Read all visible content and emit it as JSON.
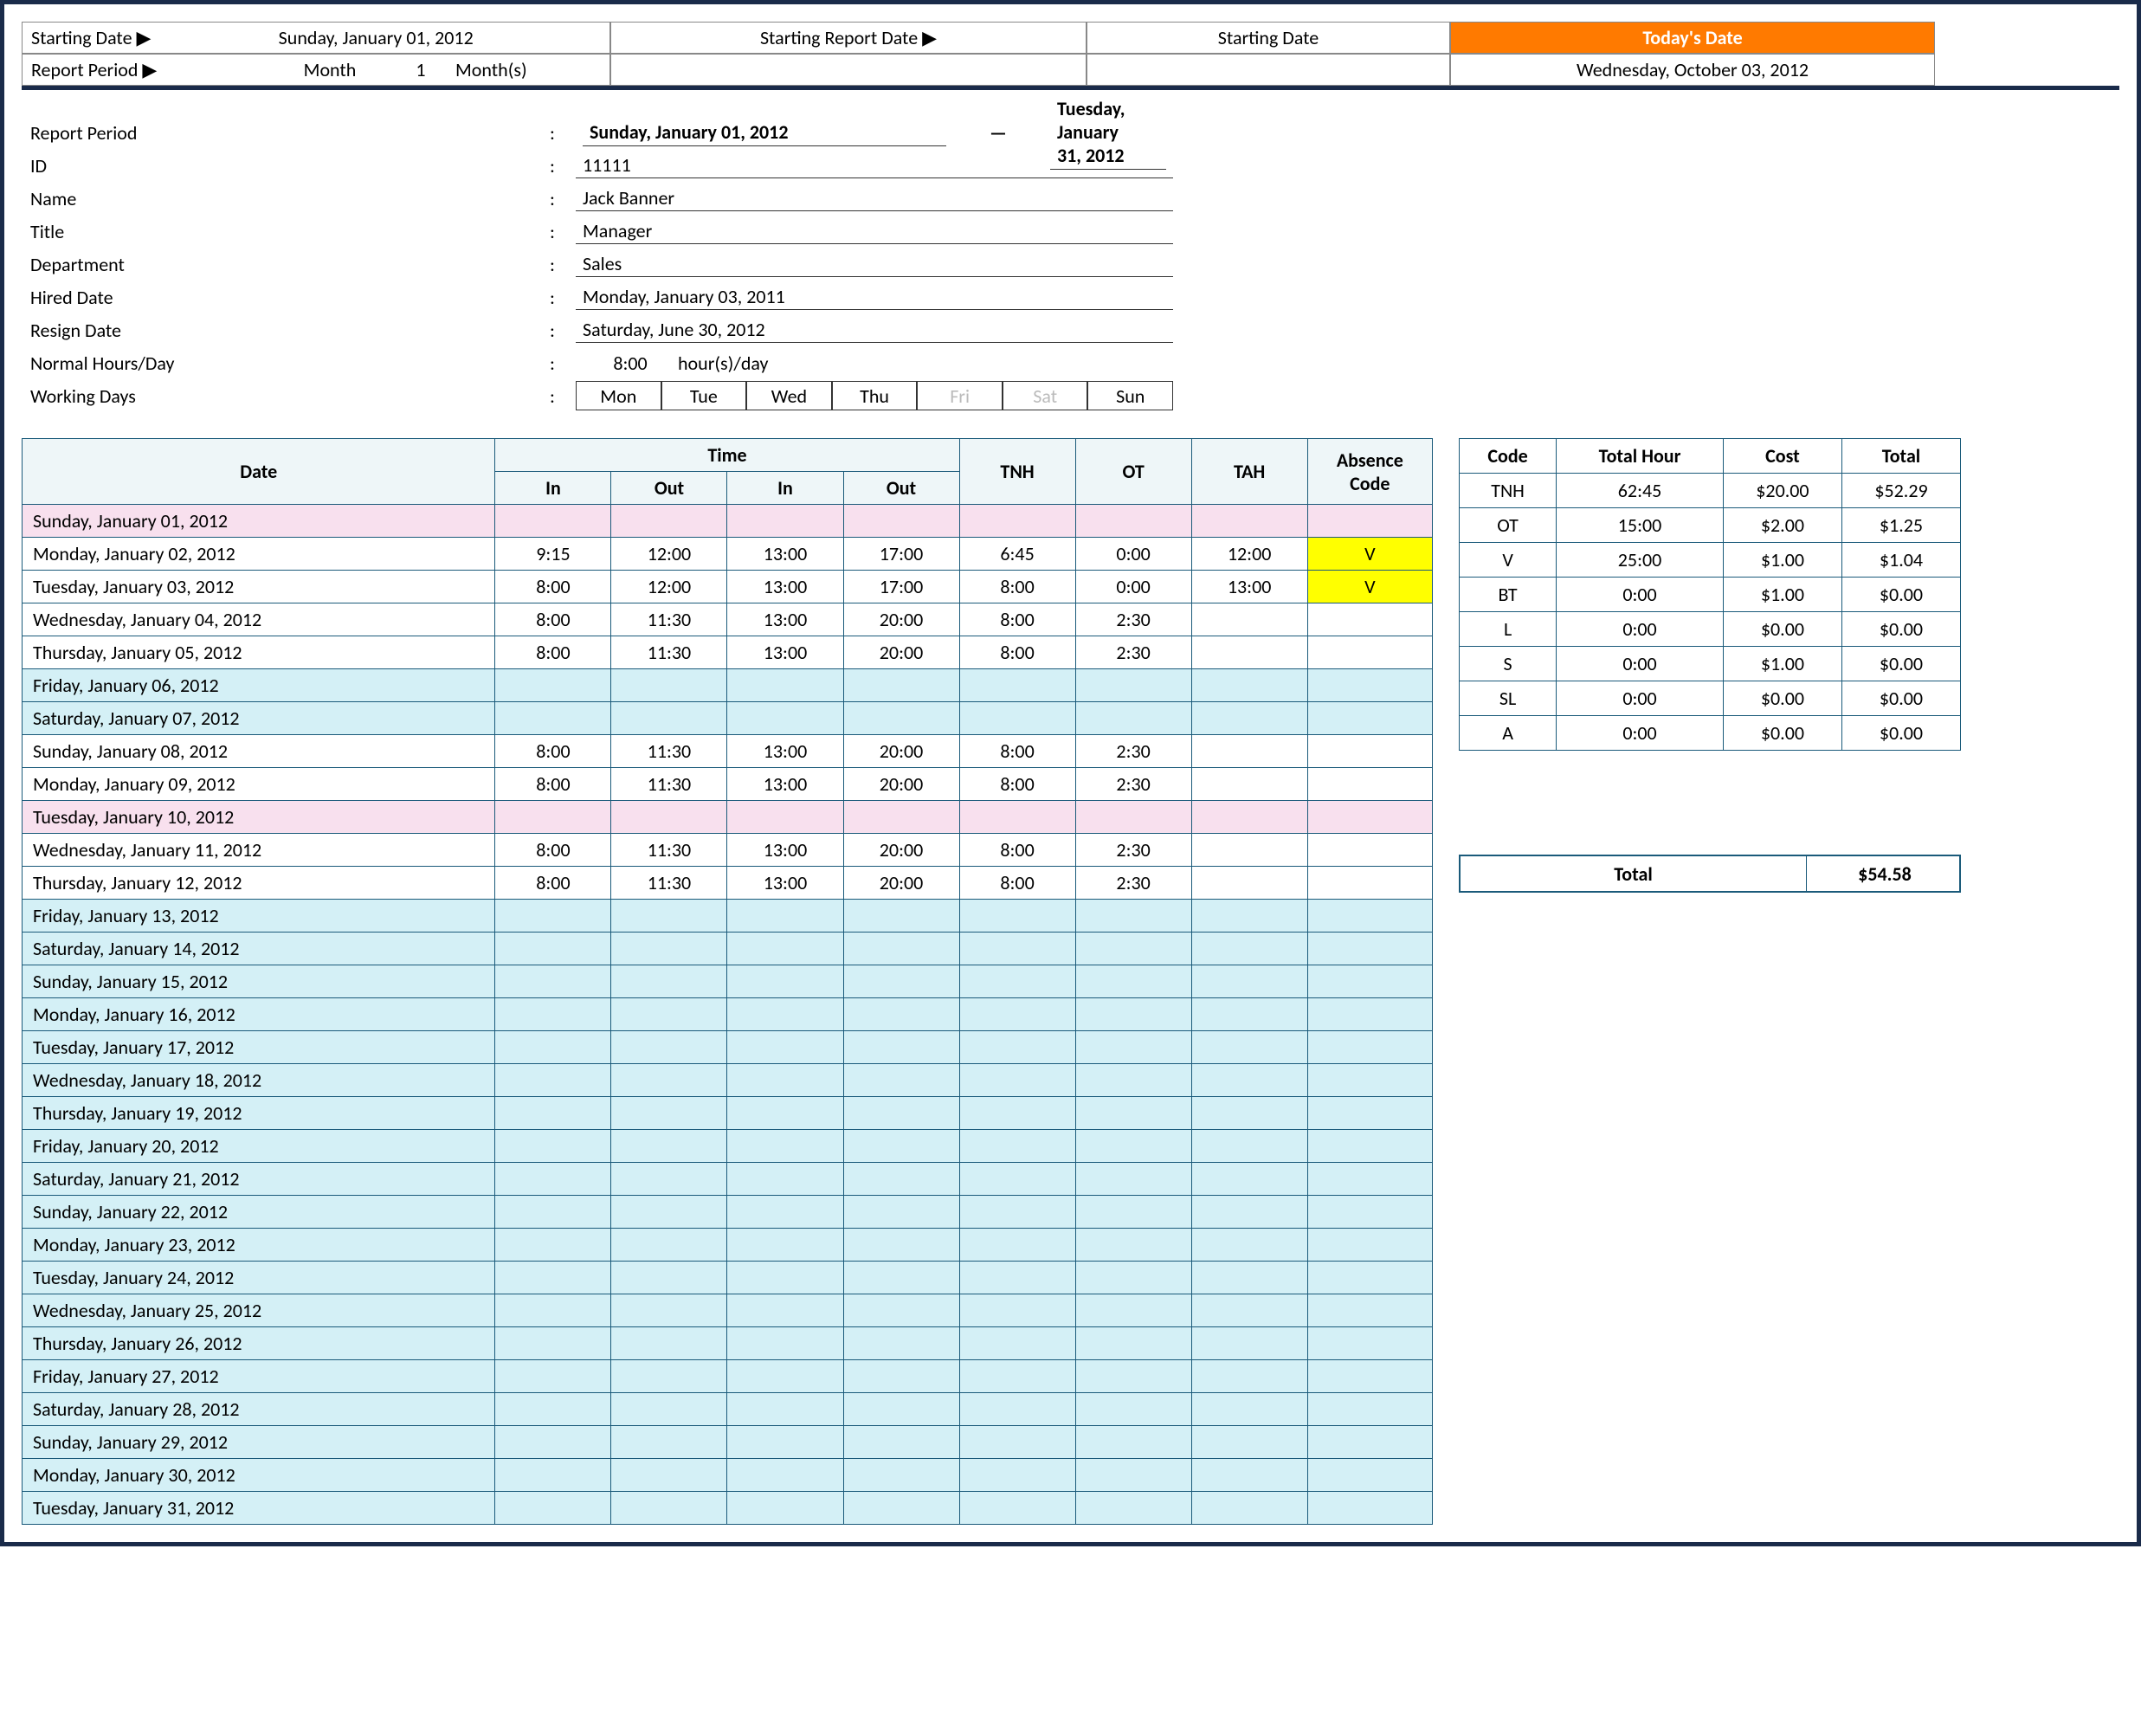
{
  "header": {
    "starting_date_label": "Starting Date ▶",
    "starting_date_value": "Sunday, January 01, 2012",
    "report_period_label": "Report Period ▶",
    "report_period_type": "Month",
    "report_period_count": "1",
    "report_period_unit": "Month(s)",
    "starting_report_date_label": "Starting Report Date ▶",
    "starting_report_date_value": "Starting Date",
    "todays_date_label": "Today's Date",
    "todays_date_value": "Wednesday, October 03, 2012"
  },
  "info": {
    "labels": {
      "report_period": "Report Period",
      "id": "ID",
      "name": "Name",
      "title": "Title",
      "department": "Department",
      "hired_date": "Hired Date",
      "resign_date": "Resign Date",
      "normal_hours": "Normal Hours/Day",
      "working_days": "Working Days"
    },
    "values": {
      "period_start": "Sunday, January 01, 2012",
      "period_sep": "—",
      "period_end": "Tuesday, January 31, 2012",
      "id": "11111",
      "name": "Jack Banner",
      "title": "Manager",
      "department": "Sales",
      "hired_date": "Monday, January 03, 2011",
      "resign_date": "Saturday, June 30, 2012",
      "hours_value": "8:00",
      "hours_unit": "hour(s)/day"
    },
    "days": [
      {
        "label": "Mon",
        "on": true
      },
      {
        "label": "Tue",
        "on": true
      },
      {
        "label": "Wed",
        "on": true
      },
      {
        "label": "Thu",
        "on": true
      },
      {
        "label": "Fri",
        "on": false
      },
      {
        "label": "Sat",
        "on": false
      },
      {
        "label": "Sun",
        "on": true
      }
    ]
  },
  "timesheet": {
    "headers": {
      "date": "Date",
      "time": "Time",
      "in": "In",
      "out": "Out",
      "tnh": "TNH",
      "ot": "OT",
      "tah": "TAH",
      "absence": "Absence Code"
    },
    "rows": [
      {
        "date": "Sunday, January 01, 2012",
        "cls": "row-pink"
      },
      {
        "date": "Monday, January 02, 2012",
        "in1": "9:15",
        "out1": "12:00",
        "in2": "13:00",
        "out2": "17:00",
        "tnh": "6:45",
        "ot": "0:00",
        "tah": "12:00",
        "abs": "V"
      },
      {
        "date": "Tuesday, January 03, 2012",
        "in1": "8:00",
        "out1": "12:00",
        "in2": "13:00",
        "out2": "17:00",
        "tnh": "8:00",
        "ot": "0:00",
        "tah": "13:00",
        "abs": "V"
      },
      {
        "date": "Wednesday, January 04, 2012",
        "in1": "8:00",
        "out1": "11:30",
        "in2": "13:00",
        "out2": "20:00",
        "tnh": "8:00",
        "ot": "2:30"
      },
      {
        "date": "Thursday, January 05, 2012",
        "in1": "8:00",
        "out1": "11:30",
        "in2": "13:00",
        "out2": "20:00",
        "tnh": "8:00",
        "ot": "2:30"
      },
      {
        "date": "Friday, January 06, 2012",
        "cls": "row-weekend"
      },
      {
        "date": "Saturday, January 07, 2012",
        "cls": "row-weekend"
      },
      {
        "date": "Sunday, January 08, 2012",
        "in1": "8:00",
        "out1": "11:30",
        "in2": "13:00",
        "out2": "20:00",
        "tnh": "8:00",
        "ot": "2:30"
      },
      {
        "date": "Monday, January 09, 2012",
        "in1": "8:00",
        "out1": "11:30",
        "in2": "13:00",
        "out2": "20:00",
        "tnh": "8:00",
        "ot": "2:30"
      },
      {
        "date": "Tuesday, January 10, 2012",
        "cls": "row-pink"
      },
      {
        "date": "Wednesday, January 11, 2012",
        "in1": "8:00",
        "out1": "11:30",
        "in2": "13:00",
        "out2": "20:00",
        "tnh": "8:00",
        "ot": "2:30"
      },
      {
        "date": "Thursday, January 12, 2012",
        "in1": "8:00",
        "out1": "11:30",
        "in2": "13:00",
        "out2": "20:00",
        "tnh": "8:00",
        "ot": "2:30"
      },
      {
        "date": "Friday, January 13, 2012",
        "cls": "row-weekend"
      },
      {
        "date": "Saturday, January 14, 2012",
        "cls": "row-weekend"
      },
      {
        "date": "Sunday, January 15, 2012",
        "cls": "row-weekend"
      },
      {
        "date": "Monday, January 16, 2012",
        "cls": "row-weekend"
      },
      {
        "date": "Tuesday, January 17, 2012",
        "cls": "row-weekend"
      },
      {
        "date": "Wednesday, January 18, 2012",
        "cls": "row-weekend"
      },
      {
        "date": "Thursday, January 19, 2012",
        "cls": "row-weekend"
      },
      {
        "date": "Friday, January 20, 2012",
        "cls": "row-weekend"
      },
      {
        "date": "Saturday, January 21, 2012",
        "cls": "row-weekend"
      },
      {
        "date": "Sunday, January 22, 2012",
        "cls": "row-weekend"
      },
      {
        "date": "Monday, January 23, 2012",
        "cls": "row-weekend"
      },
      {
        "date": "Tuesday, January 24, 2012",
        "cls": "row-weekend"
      },
      {
        "date": "Wednesday, January 25, 2012",
        "cls": "row-weekend"
      },
      {
        "date": "Thursday, January 26, 2012",
        "cls": "row-weekend"
      },
      {
        "date": "Friday, January 27, 2012",
        "cls": "row-weekend"
      },
      {
        "date": "Saturday, January 28, 2012",
        "cls": "row-weekend"
      },
      {
        "date": "Sunday, January 29, 2012",
        "cls": "row-weekend"
      },
      {
        "date": "Monday, January 30, 2012",
        "cls": "row-weekend"
      },
      {
        "date": "Tuesday, January 31, 2012",
        "cls": "row-weekend"
      }
    ]
  },
  "summary": {
    "headers": {
      "code": "Code",
      "total_hour": "Total Hour",
      "cost": "Cost",
      "total": "Total"
    },
    "rows": [
      {
        "code": "TNH",
        "hour": "62:45",
        "cost": "$20.00",
        "total": "$52.29"
      },
      {
        "code": "OT",
        "hour": "15:00",
        "cost": "$2.00",
        "total": "$1.25"
      },
      {
        "code": "V",
        "hour": "25:00",
        "cost": "$1.00",
        "total": "$1.04"
      },
      {
        "code": "BT",
        "hour": "0:00",
        "cost": "$1.00",
        "total": "$0.00"
      },
      {
        "code": "L",
        "hour": "0:00",
        "cost": "$0.00",
        "total": "$0.00"
      },
      {
        "code": "S",
        "hour": "0:00",
        "cost": "$1.00",
        "total": "$0.00"
      },
      {
        "code": "SL",
        "hour": "0:00",
        "cost": "$0.00",
        "total": "$0.00"
      },
      {
        "code": "A",
        "hour": "0:00",
        "cost": "$0.00",
        "total": "$0.00"
      }
    ],
    "grand_total_label": "Total",
    "grand_total_value": "$54.58"
  }
}
